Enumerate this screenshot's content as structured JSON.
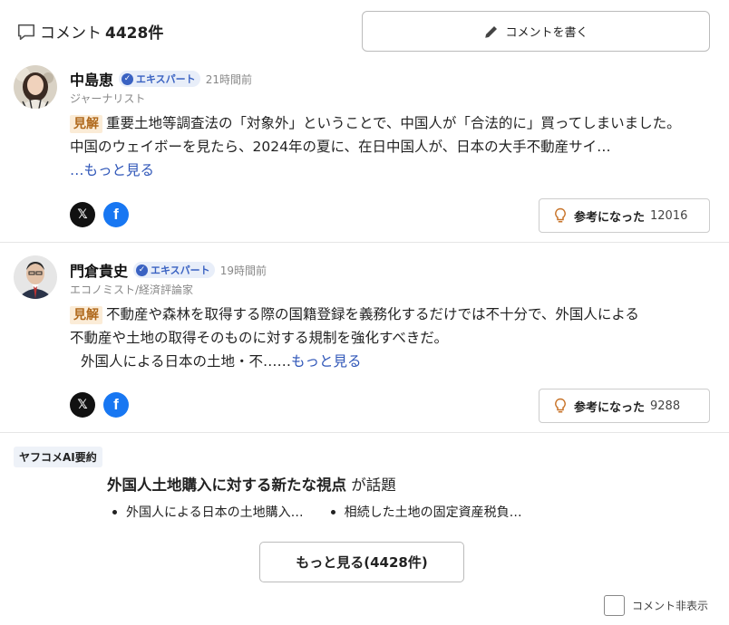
{
  "header": {
    "comment_label": "コメント",
    "comment_count": "4428件",
    "write_button_label": "コメントを書く"
  },
  "comments": [
    {
      "name": "中島恵",
      "badge": "エキスパート",
      "time": "21時間前",
      "role": "ジャーナリスト",
      "label": "見解",
      "text_line1": "重要土地等調査法の「対象外」ということで、中国人が「合法的に」買ってしまいました。",
      "text_line2": "中国のウェイボーを見たら、2024年の夏に、在日中国人が、日本の大手不動産サイ…",
      "more": "…もっと見る",
      "helpful_label": "参考になった",
      "helpful_count": "12016"
    },
    {
      "name": "門倉貴史",
      "badge": "エキスパート",
      "time": "19時間前",
      "role": "エコノミスト/経済評論家",
      "label": "見解",
      "text_line1": "不動産や森林を取得する際の国籍登録を義務化するだけでは不十分で、外国人による",
      "text_line2": "不動産や土地の取得そのものに対する規制を強化すべきだ。",
      "text_line3": "外国人による日本の土地・不……",
      "more": "もっと見る",
      "helpful_label": "参考になった",
      "helpful_count": "9288"
    }
  ],
  "ai_summary": {
    "tag": "ヤフコメAI要約",
    "topic": "外国人土地購入に対する新たな視点",
    "topic_suffix": "が話題",
    "points": [
      "外国人による日本の土地購入…",
      "相続した土地の固定資産税負…"
    ]
  },
  "footer": {
    "more_button": "もっと見る(4428件)",
    "hide_label": "コメント非表示"
  },
  "colors": {
    "accent_blue": "#3a62c2",
    "label_bg": "#fbecd7",
    "label_text": "#b0691c",
    "helpful_icon": "#c8742a",
    "facebook": "#1877f2"
  }
}
